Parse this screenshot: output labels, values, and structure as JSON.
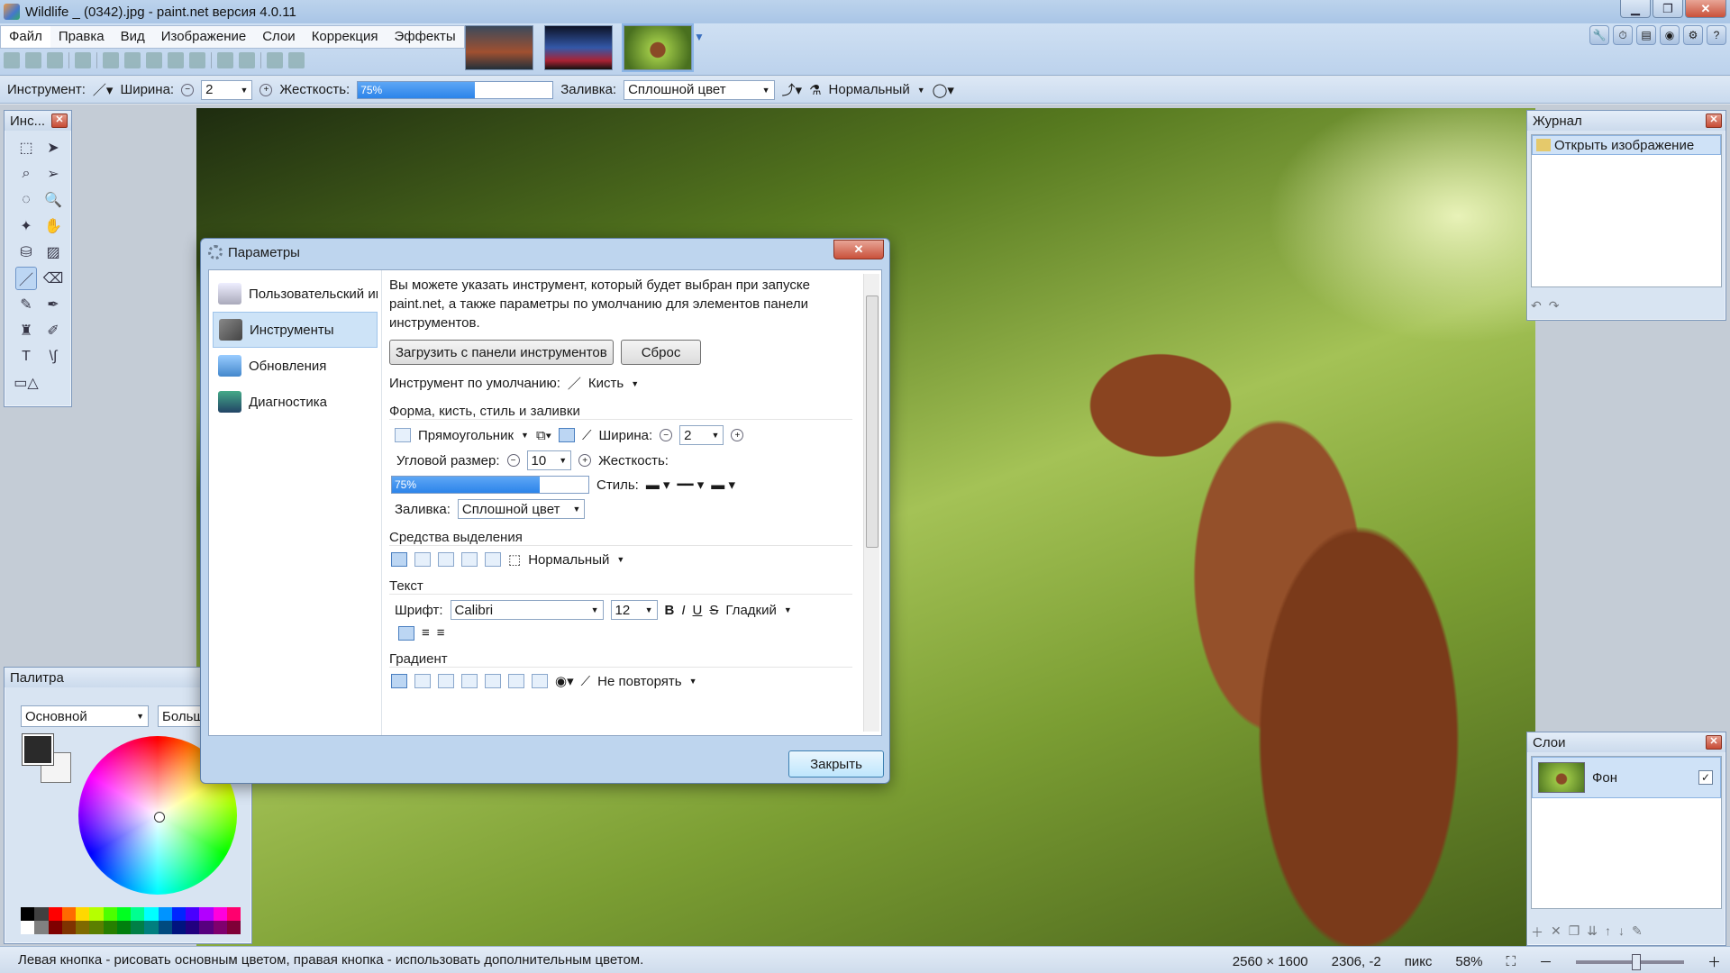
{
  "window": {
    "title": "Wildlife _ (0342).jpg - paint.net версия 4.0.11",
    "min": "▁",
    "max": "❐",
    "close": "✕"
  },
  "menu": [
    "Файл",
    "Правка",
    "Вид",
    "Изображение",
    "Слои",
    "Коррекция",
    "Эффекты"
  ],
  "optbar": {
    "tool_label": "Инструмент:",
    "width_label": "Ширина:",
    "width_value": "2",
    "hardness_label": "Жесткость:",
    "hardness_value": "75%",
    "hardness_fraction": 0.6,
    "fill_label": "Заливка:",
    "fill_value": "Сплошной цвет",
    "blend_value": "Нормальный"
  },
  "tools_panel": {
    "title": "Инс..."
  },
  "palette_panel": {
    "title": "Палитра",
    "mode": "Основной",
    "size": "Больш"
  },
  "history_panel": {
    "title": "Журнал",
    "item": "Открыть изображение"
  },
  "layers_panel": {
    "title": "Слои",
    "layer_name": "Фон",
    "check": "✓"
  },
  "statusbar": {
    "hint": "Левая кнопка - рисовать основным цветом, правая кнопка - использовать дополнительным цветом.",
    "image_size": "2560 × 1600",
    "cursor_pos": "2306, -2",
    "units": "пикс",
    "zoom": "58%"
  },
  "dialog": {
    "title": "Параметры",
    "nav": [
      "Пользовательский интерфейс",
      "Инструменты",
      "Обновления",
      "Диагностика"
    ],
    "intro": "Вы можете указать инструмент, который будет выбран при запуске paint.net, а также параметры по умолчанию для элементов панели инструментов.",
    "load_btn": "Загрузить с панели инструментов",
    "reset_btn": "Сброс",
    "default_tool_label": "Инструмент по умолчанию:",
    "default_tool_value": "Кисть",
    "shape_section": "Форма, кисть, стиль и заливки",
    "shape_value": "Прямоугольник",
    "width_label": "Ширина:",
    "width_value": "2",
    "corner_label": "Угловой размер:",
    "corner_value": "10",
    "hardness_label": "Жесткость:",
    "hardness_value": "75%",
    "style_label": "Стиль:",
    "fill_label": "Заливка:",
    "fill_value": "Сплошной цвет",
    "selection_section": "Средства выделения",
    "selection_mode": "Нормальный",
    "text_section": "Текст",
    "font_label": "Шрифт:",
    "font_value": "Calibri",
    "font_size": "12",
    "bold": "B",
    "italic": "I",
    "underline": "U",
    "strike": "S",
    "smoothing": "Гладкий",
    "gradient_section": "Градиент",
    "gradient_repeat": "Не повторять",
    "close_btn": "Закрыть"
  },
  "colors": {
    "accent": "#2c84ea",
    "primary_color": "#2a2a2a",
    "secondary_color": "#f4f4f4"
  }
}
